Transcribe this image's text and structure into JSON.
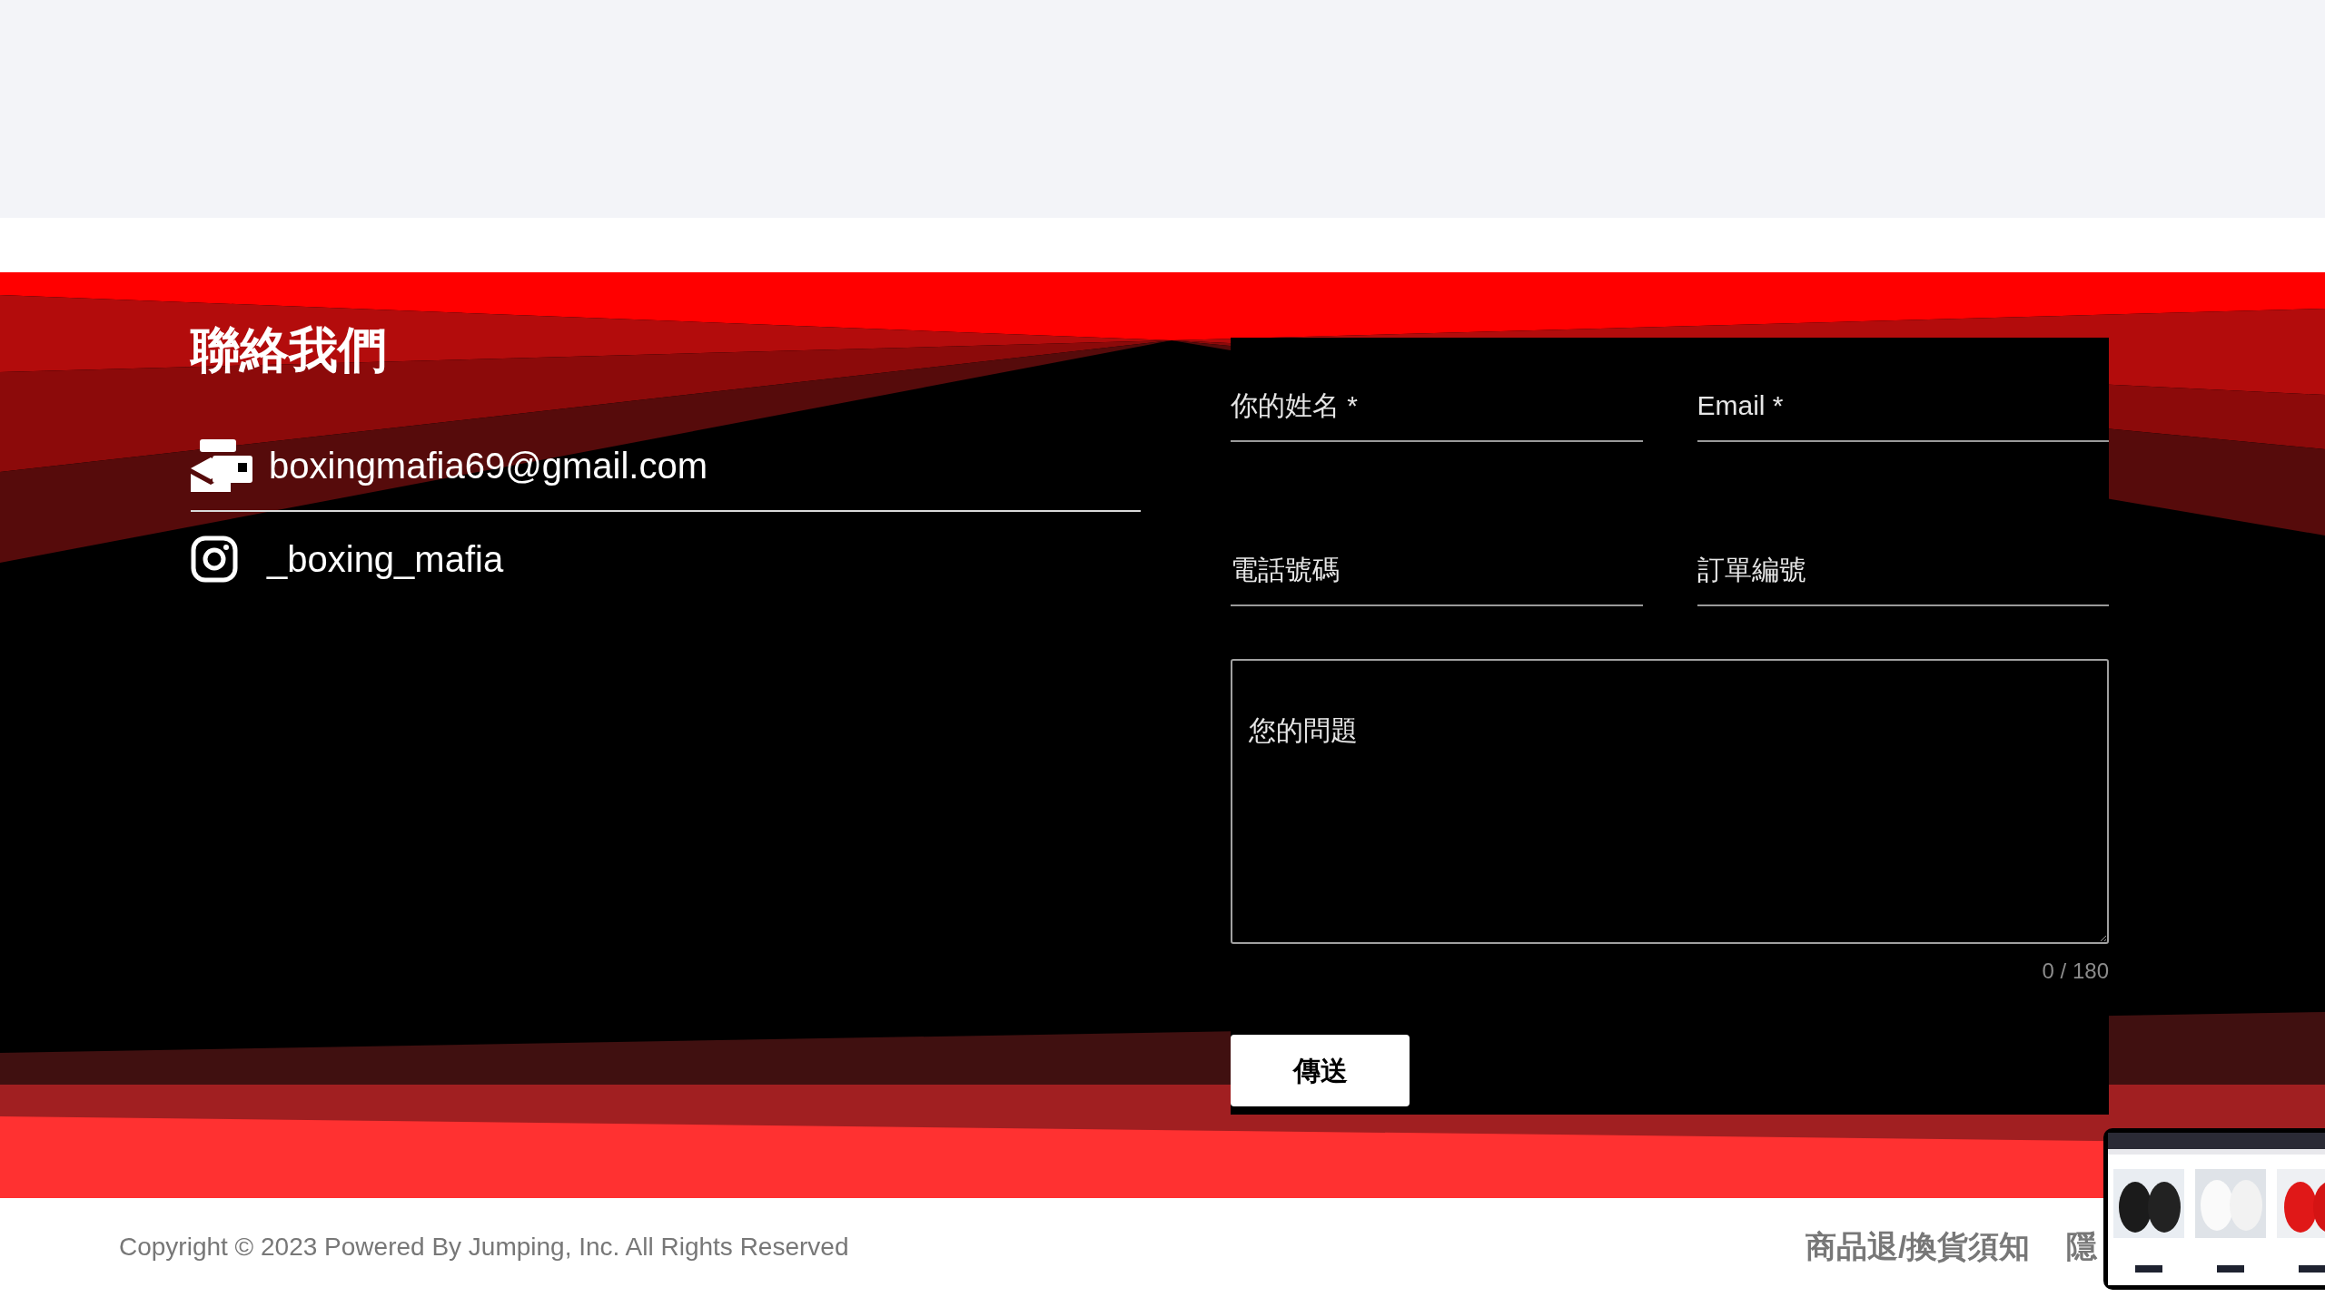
{
  "contact": {
    "title": "聯絡我們",
    "items": [
      {
        "kind": "email",
        "text": "boxingmafia69@gmail.com"
      },
      {
        "kind": "instagram",
        "text": "_boxing_mafia"
      }
    ]
  },
  "form": {
    "fields": [
      {
        "placeholder": "你的姓名 *"
      },
      {
        "placeholder": "Email *"
      },
      {
        "placeholder": "電話號碼"
      },
      {
        "placeholder": "訂單編號"
      }
    ],
    "message": {
      "placeholder": "您的問題"
    },
    "counter": "0 / 180",
    "submit": "傳送"
  },
  "footer": {
    "copyright": "Copyright © 2023 Powered By Jumping, Inc. All Rights Reserved",
    "links": [
      "商品退/換貨須知",
      "隱"
    ]
  }
}
